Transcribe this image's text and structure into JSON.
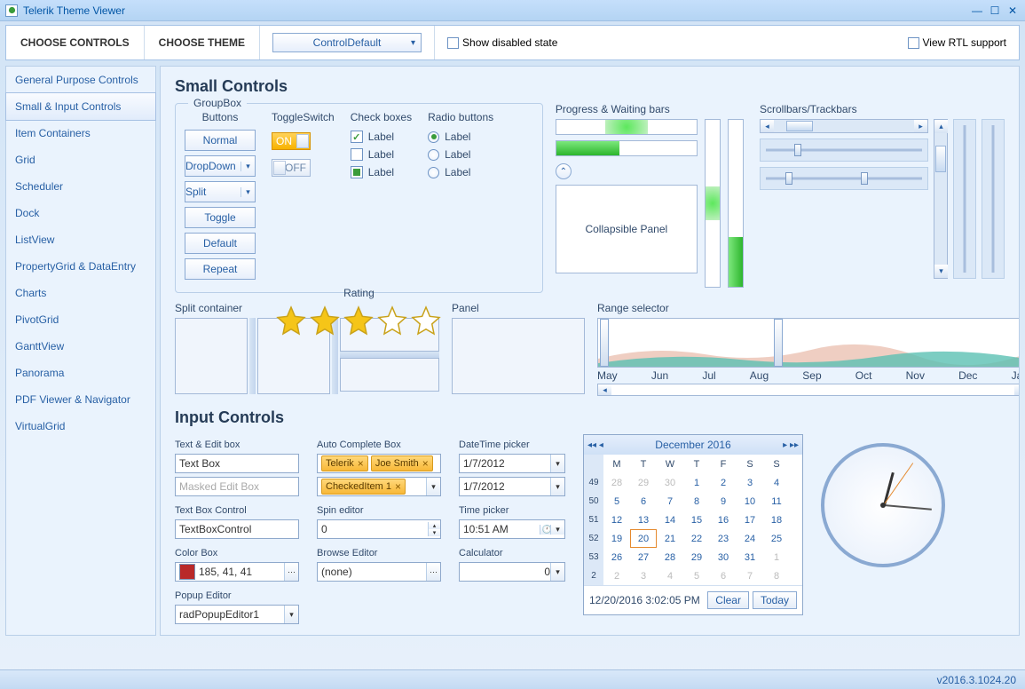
{
  "window": {
    "title": "Telerik Theme Viewer"
  },
  "tabs": {
    "controls": "CHOOSE CONTROLS",
    "theme": "CHOOSE THEME"
  },
  "themeCombo": "ControlDefault",
  "showDisabled": "Show disabled state",
  "rtl": "View RTL support",
  "sidebar": {
    "items": [
      "General Purpose Controls",
      "Small & Input Controls",
      "Item Containers",
      "Grid",
      "Scheduler",
      "Dock",
      "ListView",
      "PropertyGrid & DataEntry",
      "Charts",
      "PivotGrid",
      "GanttView",
      "Panorama",
      "PDF Viewer & Navigator",
      "VirtualGrid"
    ],
    "activeIndex": 1
  },
  "headings": {
    "small": "Small Controls",
    "input": "Input Controls"
  },
  "groupbox": {
    "title": "GroupBox",
    "buttonsHdr": "Buttons",
    "toggleHdr": "ToggleSwitch",
    "checkHdr": "Check boxes",
    "radioHdr": "Radio buttons",
    "ratingHdr": "Rating",
    "buttons": [
      "Normal",
      "DropDown",
      "Split",
      "Toggle",
      "Default",
      "Repeat"
    ],
    "on": "ON",
    "off": "OFF",
    "checkLabels": [
      "Label",
      "Label",
      "Label"
    ],
    "radioLabels": [
      "Label",
      "Label",
      "Label"
    ],
    "ratingValue": 3,
    "ratingMax": 5
  },
  "progress": {
    "title": "Progress & Waiting bars",
    "collapse": "Collapsible Panel"
  },
  "scrollbars": {
    "title": "Scrollbars/Trackbars"
  },
  "splitContainer": {
    "title": "Split container"
  },
  "panel": {
    "title": "Panel"
  },
  "range": {
    "title": "Range selector",
    "months": [
      "May",
      "Jun",
      "Jul",
      "Aug",
      "Sep",
      "Oct",
      "Nov",
      "Dec",
      "Jan"
    ]
  },
  "inputs": {
    "textEdit": {
      "lbl": "Text & Edit box",
      "textbox": "Text Box",
      "masked": "Masked Edit Box"
    },
    "textBoxControl": {
      "lbl": "Text Box Control",
      "val": "TextBoxControl"
    },
    "colorBox": {
      "lbl": "Color Box",
      "val": "185, 41, 41",
      "color": "#b92929"
    },
    "popup": {
      "lbl": "Popup Editor",
      "val": "radPopupEditor1"
    },
    "autoComplete": {
      "lbl": "Auto Complete Box",
      "tokens1": [
        "Telerik",
        "Joe Smith"
      ],
      "tokens2": [
        "CheckedItem 1"
      ]
    },
    "spin": {
      "lbl": "Spin editor",
      "val": "0"
    },
    "browse": {
      "lbl": "Browse Editor",
      "val": "(none)"
    },
    "dateTime": {
      "lbl": "DateTime picker",
      "val1": "1/7/2012",
      "val2": "1/7/2012"
    },
    "time": {
      "lbl": "Time picker",
      "val": "10:51 AM"
    },
    "calc": {
      "lbl": "Calculator",
      "val": "0"
    }
  },
  "calendar": {
    "header": "December 2016",
    "dow": [
      "M",
      "T",
      "W",
      "T",
      "F",
      "S",
      "S"
    ],
    "weeks": [
      {
        "wk": "49",
        "days": [
          {
            "d": "28",
            "dim": true
          },
          {
            "d": "29",
            "dim": true
          },
          {
            "d": "30",
            "dim": true
          },
          {
            "d": "1"
          },
          {
            "d": "2"
          },
          {
            "d": "3"
          },
          {
            "d": "4"
          }
        ]
      },
      {
        "wk": "50",
        "days": [
          {
            "d": "5"
          },
          {
            "d": "6"
          },
          {
            "d": "7"
          },
          {
            "d": "8"
          },
          {
            "d": "9"
          },
          {
            "d": "10"
          },
          {
            "d": "11"
          }
        ]
      },
      {
        "wk": "51",
        "days": [
          {
            "d": "12"
          },
          {
            "d": "13"
          },
          {
            "d": "14"
          },
          {
            "d": "15"
          },
          {
            "d": "16"
          },
          {
            "d": "17"
          },
          {
            "d": "18"
          }
        ]
      },
      {
        "wk": "52",
        "days": [
          {
            "d": "19"
          },
          {
            "d": "20",
            "today": true
          },
          {
            "d": "21"
          },
          {
            "d": "22"
          },
          {
            "d": "23"
          },
          {
            "d": "24"
          },
          {
            "d": "25"
          }
        ]
      },
      {
        "wk": "53",
        "days": [
          {
            "d": "26"
          },
          {
            "d": "27"
          },
          {
            "d": "28"
          },
          {
            "d": "29"
          },
          {
            "d": "30"
          },
          {
            "d": "31"
          },
          {
            "d": "1",
            "dim": true
          }
        ]
      },
      {
        "wk": "2",
        "days": [
          {
            "d": "2",
            "dim": true
          },
          {
            "d": "3",
            "dim": true
          },
          {
            "d": "4",
            "dim": true
          },
          {
            "d": "5",
            "dim": true
          },
          {
            "d": "6",
            "dim": true
          },
          {
            "d": "7",
            "dim": true
          },
          {
            "d": "8",
            "dim": true
          }
        ]
      }
    ],
    "footer": "12/20/2016 3:02:05 PM",
    "clear": "Clear",
    "today": "Today"
  },
  "status": "v2016.3.1024.20"
}
